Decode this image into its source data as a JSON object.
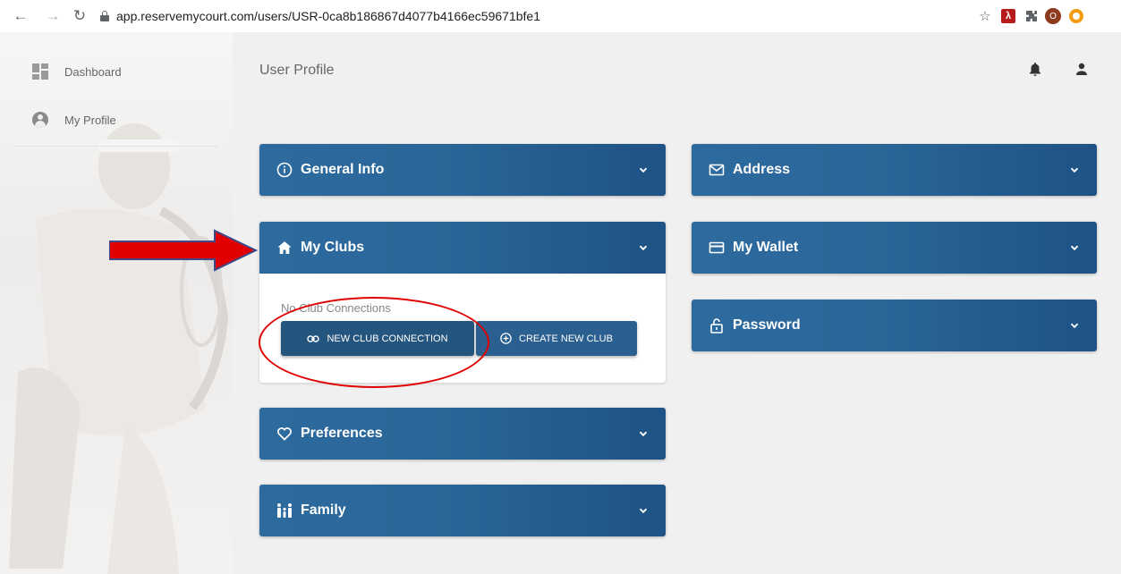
{
  "browser": {
    "url": "app.reservemycourt.com/users/USR-0ca8b186867d4077b4166ec59671bfe1",
    "back_icon": "arrow-left-icon",
    "forward_icon": "arrow-right-icon",
    "reload_icon": "reload-icon",
    "avatar_letter": "O"
  },
  "sidebar": {
    "items": [
      {
        "label": "Dashboard",
        "icon": "dashboard-icon"
      },
      {
        "label": "My Profile",
        "icon": "account-circle-icon"
      }
    ]
  },
  "header": {
    "title": "User Profile"
  },
  "panels": {
    "general_info": "General Info",
    "my_clubs": "My Clubs",
    "preferences": "Preferences",
    "family": "Family",
    "address": "Address",
    "my_wallet": "My Wallet",
    "password": "Password"
  },
  "clubs": {
    "empty_text": "No Club Connections",
    "new_connection_label": "NEW CLUB CONNECTION",
    "create_club_label": "CREATE NEW CLUB"
  },
  "colors": {
    "panel": "#2b6699",
    "button": "#2a5f8f",
    "annotation": "#e00000"
  }
}
